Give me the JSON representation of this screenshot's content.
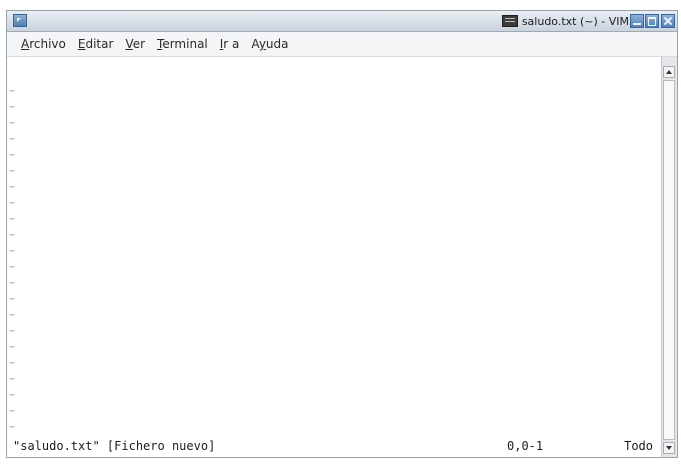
{
  "window": {
    "title": "saludo.txt (~) - VIM",
    "icons": [
      "window-menu-icon",
      "terminal-icon",
      "minimize-icon",
      "maximize-icon",
      "close-icon"
    ]
  },
  "menu": {
    "items": [
      {
        "mnemonic": "A",
        "rest": "rchivo"
      },
      {
        "mnemonic": "E",
        "rest": "ditar"
      },
      {
        "mnemonic": "V",
        "rest": "er"
      },
      {
        "mnemonic": "T",
        "rest": "erminal"
      },
      {
        "mnemonic": "I",
        "rest": "r a"
      },
      {
        "pre": "A",
        "mnemonic": "y",
        "rest": "uda"
      }
    ]
  },
  "editor": {
    "empty_line_marker": "~",
    "empty_line_count": 22
  },
  "status": {
    "message": "\"saludo.txt\" [Fichero nuevo]",
    "position": "0,0-1",
    "scroll": "Todo"
  }
}
